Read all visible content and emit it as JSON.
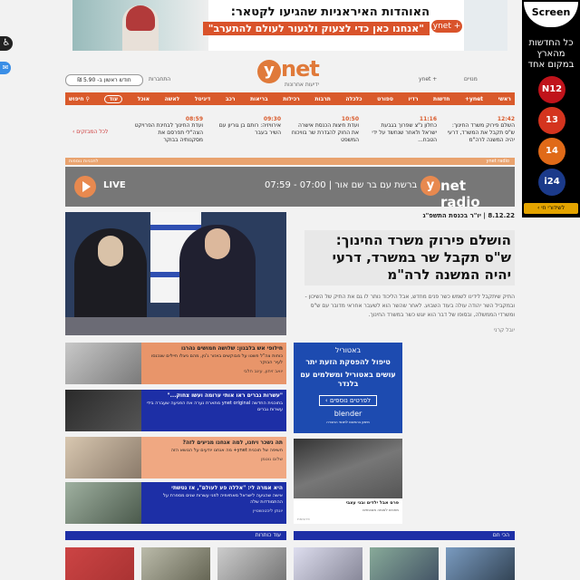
{
  "top_banner": {
    "headline": "האוהדות האיראניות שהגיעו לקטאר:",
    "subline": "\"אנחנו כאן כדי לצעוק ולגעור לעולם להתערב\"",
    "brand_button": "ynet +"
  },
  "side_ad": {
    "brand": "Screen",
    "text": "כל החדשות מהארץ במקום אחד",
    "channels": [
      "N12",
      "13",
      "14",
      "i24"
    ],
    "footer": "לשידורי חי ›"
  },
  "accessibility": {
    "icon": "accessibility-icon"
  },
  "chat": {
    "icon": "chat-icon"
  },
  "header": {
    "logo_letter": "y",
    "logo_word": "net",
    "logo_sub": "ידיעות אחרונות",
    "links_right": [
      "ynet +",
      "מנויים"
    ],
    "link_left": "התחברות",
    "subscribe": "חודש ראשון ב- 5.90 ₪"
  },
  "nav": {
    "items": [
      "ראשי",
      "ynet+",
      "חדשות",
      "רדיו",
      "ספורט",
      "כלכלה",
      "תרבות",
      "רכילות",
      "בריאות",
      "רכב",
      "דיגיטל",
      "לאשה",
      "אוכל",
      "עוד",
      "חיפוש"
    ]
  },
  "ticker": {
    "all_link": "לכל המבזקים ›",
    "items": [
      {
        "time": "12:42",
        "text": "השלם פירוק משרד החינוך: ש\"ס תקבל את המשרד, דרעי יהיה המשנה לרה\"מ"
      },
      {
        "time": "11:16",
        "text": "כחלון נ\"צ שפרוך בגבעת ישראל ולאחר שנחשד על ידי הטבח..."
      },
      {
        "time": "10:50",
        "text": "ועדת חיצות הכנסת אישרה את החוק להגדרת שר בוויכוח המשפט"
      },
      {
        "time": "09:30",
        "text": "אירוויזיה: רותם בן גוריון עם השיר בעבר"
      },
      {
        "time": "08:59",
        "text": "ועדת החינוך לבחינת הפרויקט הצה\"לי תפרסם את מסקנותיה בבוקר"
      }
    ]
  },
  "radio": {
    "bar_left": "ynet radio",
    "bar_right": "לתכניות נוספות",
    "live": "LIVE",
    "show": "ברשת עם בר שם אור | 07:00 - 07:59",
    "brand_letter": "y",
    "brand": "net radio"
  },
  "main_story": {
    "kicker": "8.12.22 | יו\"ר בכנסת התשפ\"ג",
    "headline": "הושלם פירוק משרד החינוך: ש\"ס תקבל שר במשרד, דרעי יהיה המשנה לרה\"מ",
    "summary": "התיק שיתקבל לידינו לשמש כשר פנים מחדש, אבל הליכוד נותר לו גם את התיק של השיכון - ובמקביל השר יהודה עולה בעוד השבוע. לאחר שהשר הוא לשעבר אחראי מדובר עם ש\"ס ומשרדי הממשלה, ובסופו של דבר הוא יוגש כשר במשרד החינוך.",
    "author": "יובל קרני"
  },
  "cards": [
    {
      "headline": "חילופי אש בלבנון: שלושה חמושים נהרגו",
      "summary": "כוחות צה\"ל פשטו על מבוקשים באזור ג'נין, מהם ניצלו חיילים שנכנסו לעיר הבוקר",
      "author": "יואב זיתון, עינב חלבי",
      "bg": "#e8956a",
      "color": "#222"
    },
    {
      "headline": "\"עשרות גברים ראו אותי ערומה ועשו צחוק...\"",
      "summary": "בתוכנית החדשה ynet original מתארת נערה את הפגיעה שעברה בידי עשרות גברים",
      "author": "",
      "bg": "#1d2fa6",
      "color": "#fff"
    },
    {
      "headline": "תה נשכר ויחנו, למה אנחנו מגיעים לזה?",
      "summary": "חשיפה של תוכנית ynet+ מה אנחנו יודעים על הנושא הזה",
      "author": "שלום גוטמן",
      "bg": "#f0a882",
      "color": "#222"
    },
    {
      "headline": "היא אמרה לי: \"אללה פע לעולם\", אז נטשתי",
      "summary": "אישה שהגיעה לישראל מאתיופיה לפני עשרות שנים מספרת על ההתמודדות שלה",
      "author": "יונתן ליכטנשטיין",
      "bg": "#1d2fa6",
      "color": "#fff"
    }
  ],
  "ad_zap": {
    "brand": "באטוריל",
    "line1": "טיפול להפסקת הזעת יתר",
    "line2": "עושים באטוריל ומשלמים עם בלנדר",
    "button": "לפרטים נוספים ›",
    "blender": "blender",
    "small": "מימון בהתאם לתנאי החברה"
  },
  "ad_ret": {
    "title": "פרס אבל ילדים ובני עצבי",
    "sub": "מחכים לאומה מובטחים",
    "ad_label": "פרסומת"
  },
  "sections": {
    "left_bar": "עוד כותרות",
    "right_bar": "הכי חם"
  }
}
